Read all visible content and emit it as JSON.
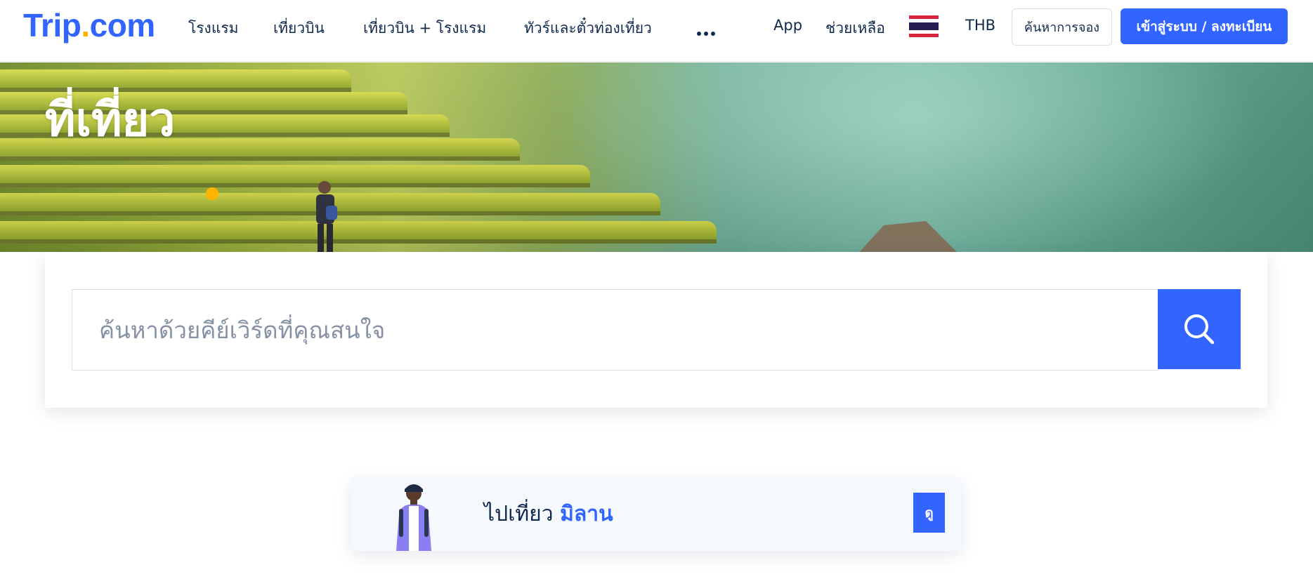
{
  "header": {
    "logo_main": "Trip",
    "logo_dot": ".",
    "logo_suffix": "com",
    "nav": [
      "โรงแรม",
      "เที่ยวบิน",
      "เที่ยวบิน + โรงแรม",
      "ทัวร์และตั๋วท่องเที่ยว"
    ],
    "more_icon": "more-dots-icon",
    "app_label": "App",
    "help_label": "ช่วยเหลือ",
    "language_flag": "thai-flag-icon",
    "currency": "THB",
    "find_booking_label": "ค้นหาการจอง",
    "login_label": "เข้าสู่ระบบ / ลงทะเบียน"
  },
  "hero": {
    "title": "ที่เที่ยว"
  },
  "search": {
    "placeholder": "ค้นหาด้วยคีย์เวิร์ดที่คุณสนใจ",
    "button_icon": "search-icon"
  },
  "promo": {
    "prefix": "ไปเที่ยว",
    "city": "มิลาน",
    "button_label": "ดู"
  },
  "colors": {
    "brand": "#3264ff",
    "accent": "#ffb400",
    "text": "#0f294d"
  }
}
